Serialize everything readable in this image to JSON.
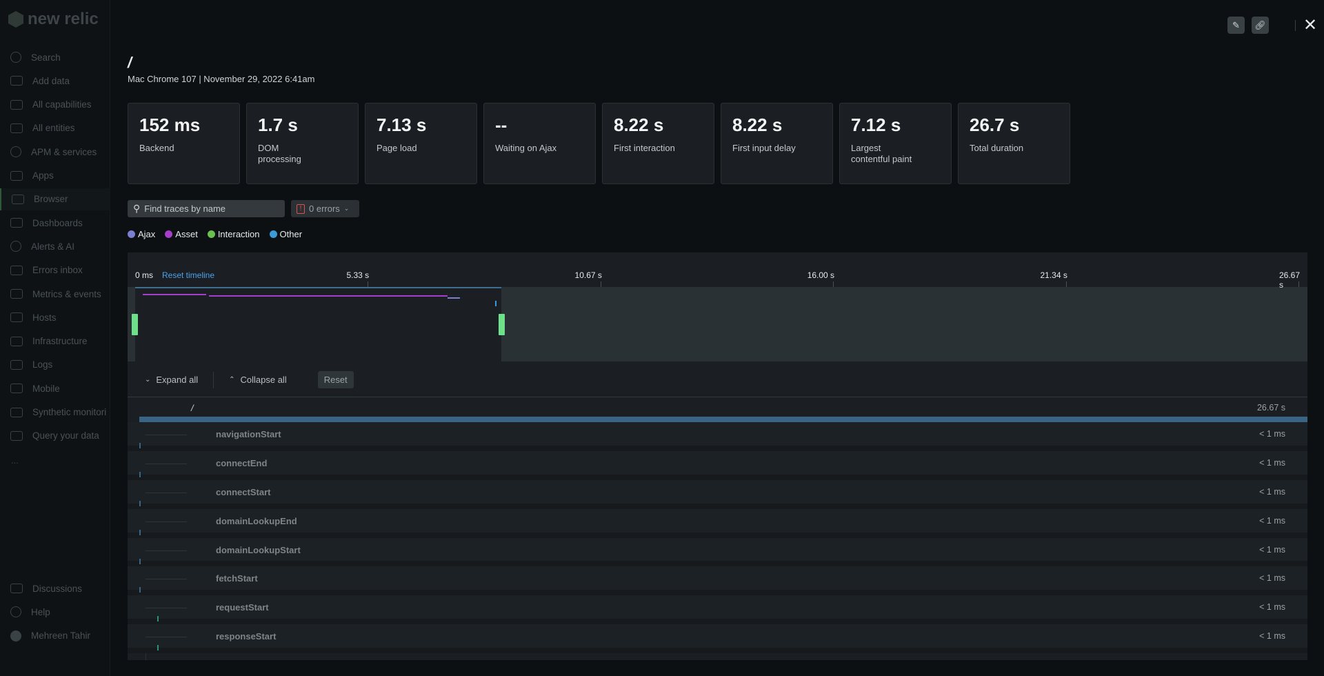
{
  "brand": {
    "name": "new relic"
  },
  "sidebar": {
    "items": [
      {
        "label": "Search",
        "icon": "search-icon"
      },
      {
        "label": "Add data",
        "icon": "plus-icon"
      },
      {
        "label": "All capabilities",
        "icon": "grid-icon"
      },
      {
        "label": "All entities",
        "icon": "entities-icon"
      },
      {
        "label": "APM & services",
        "icon": "globe-icon"
      },
      {
        "label": "Apps",
        "icon": "layers-icon"
      },
      {
        "label": "Browser",
        "icon": "browser-icon",
        "active": true
      },
      {
        "label": "Dashboards",
        "icon": "dashboard-icon"
      },
      {
        "label": "Alerts & AI",
        "icon": "alert-icon"
      },
      {
        "label": "Errors inbox",
        "icon": "inbox-icon"
      },
      {
        "label": "Metrics & events",
        "icon": "bar-chart-icon"
      },
      {
        "label": "Hosts",
        "icon": "server-icon"
      },
      {
        "label": "Infrastructure",
        "icon": "infrastructure-icon"
      },
      {
        "label": "Logs",
        "icon": "file-icon"
      },
      {
        "label": "Mobile",
        "icon": "mobile-icon"
      },
      {
        "label": "Synthetic monitori",
        "icon": "robot-icon"
      },
      {
        "label": "Query your data",
        "icon": "terminal-icon"
      }
    ],
    "more": "...",
    "bottom": [
      {
        "label": "Discussions",
        "icon": "chat-icon"
      },
      {
        "label": "Help",
        "icon": "help-icon"
      },
      {
        "label": "Mehreen Tahir",
        "icon": "avatar"
      }
    ]
  },
  "header": {
    "title": "/",
    "subtitle": "Mac Chrome 107 | November 29, 2022 6:41am"
  },
  "metrics": [
    {
      "value": "152 ms",
      "label": "Backend"
    },
    {
      "value": "1.7 s",
      "label": "DOM processing"
    },
    {
      "value": "7.13 s",
      "label": "Page load"
    },
    {
      "value": "--",
      "label": "Waiting on Ajax"
    },
    {
      "value": "8.22 s",
      "label": "First interaction"
    },
    {
      "value": "8.22 s",
      "label": "First input delay"
    },
    {
      "value": "7.12 s",
      "label": "Largest contentful paint"
    },
    {
      "value": "26.7 s",
      "label": "Total duration"
    }
  ],
  "filters": {
    "search_placeholder": "Find traces by name",
    "errors_label": "0 errors"
  },
  "legend": [
    {
      "label": "Ajax",
      "color": "#7b7fd0"
    },
    {
      "label": "Asset",
      "color": "#a53ecb"
    },
    {
      "label": "Interaction",
      "color": "#6ac04f"
    },
    {
      "label": "Other",
      "color": "#3d9ad8"
    }
  ],
  "timeline": {
    "reset_label": "Reset timeline",
    "ticks": [
      "0 ms",
      "5.33 s",
      "10.67 s",
      "16.00 s",
      "21.34 s",
      "26.67 s"
    ],
    "tick_values": [
      0,
      5.33,
      10.67,
      16.0,
      21.34,
      26.67
    ],
    "max": 26.67,
    "selection": [
      0,
      8.4
    ]
  },
  "toolbar": {
    "expand": "Expand all",
    "collapse": "Collapse all",
    "reset": "Reset"
  },
  "trace": {
    "root": {
      "name": "/",
      "duration": "26.67 s"
    },
    "rows": [
      {
        "name": "navigationStart",
        "duration": "< 1 ms"
      },
      {
        "name": "connectEnd",
        "duration": "< 1 ms"
      },
      {
        "name": "connectStart",
        "duration": "< 1 ms"
      },
      {
        "name": "domainLookupEnd",
        "duration": "< 1 ms"
      },
      {
        "name": "domainLookupStart",
        "duration": "< 1 ms"
      },
      {
        "name": "fetchStart",
        "duration": "< 1 ms"
      },
      {
        "name": "requestStart",
        "duration": "< 1 ms"
      },
      {
        "name": "responseStart",
        "duration": "< 1 ms"
      }
    ]
  }
}
